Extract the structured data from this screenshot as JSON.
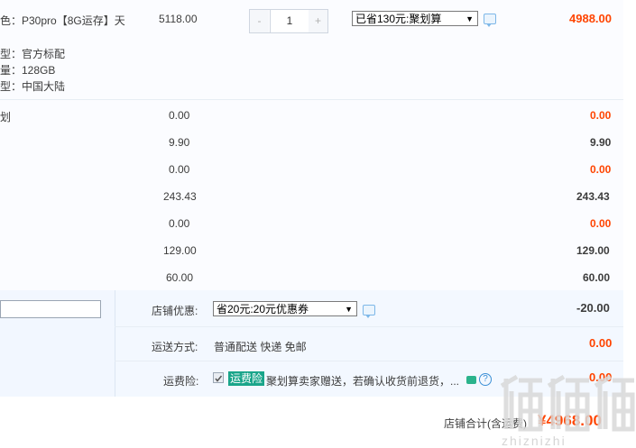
{
  "item": {
    "title": "色：P30pro【8G运存】天",
    "specs": [
      "型：官方标配",
      "量：128GB",
      "型：中国大陆"
    ],
    "price": "5118.00",
    "quantity": "1",
    "minus": "-",
    "plus": "+",
    "promo_select": "已省130元:聚划算",
    "subtotal": "4988.00"
  },
  "addon_rows": [
    {
      "label": "划",
      "price": "0.00",
      "subtotal": "0.00",
      "highlight": true
    },
    {
      "label": "",
      "price": "9.90",
      "subtotal": "9.90",
      "highlight": false
    },
    {
      "label": "",
      "price": "0.00",
      "subtotal": "0.00",
      "highlight": true
    },
    {
      "label": "",
      "price": "243.43",
      "subtotal": "243.43",
      "highlight": false
    },
    {
      "label": "",
      "price": "0.00",
      "subtotal": "0.00",
      "highlight": true
    },
    {
      "label": "",
      "price": "129.00",
      "subtotal": "129.00",
      "highlight": false
    },
    {
      "label": "",
      "price": "60.00",
      "subtotal": "60.00",
      "highlight": false
    }
  ],
  "store": {
    "discount_label": "店铺优惠:",
    "discount_select": "省20元:20元优惠券",
    "discount_value": "-20.00",
    "shipping_label": "运送方式:",
    "shipping_value": "普通配送 快递 免邮",
    "shipping_cost": "0.00",
    "insurance_label": "运费险:",
    "insurance_badge": "运费险",
    "insurance_text": "聚划算卖家赠送，若确认收货前退货，...",
    "insurance_cost": "0.00"
  },
  "total": {
    "label": "店铺合计(含运费)",
    "value": "¥4968.00"
  },
  "watermark": {
    "line1": "值值值",
    "line2": "zhiznizhi"
  },
  "colors": {
    "accent": "#ff4400",
    "badge": "#1aa58a",
    "info": "#3b8fd6"
  }
}
